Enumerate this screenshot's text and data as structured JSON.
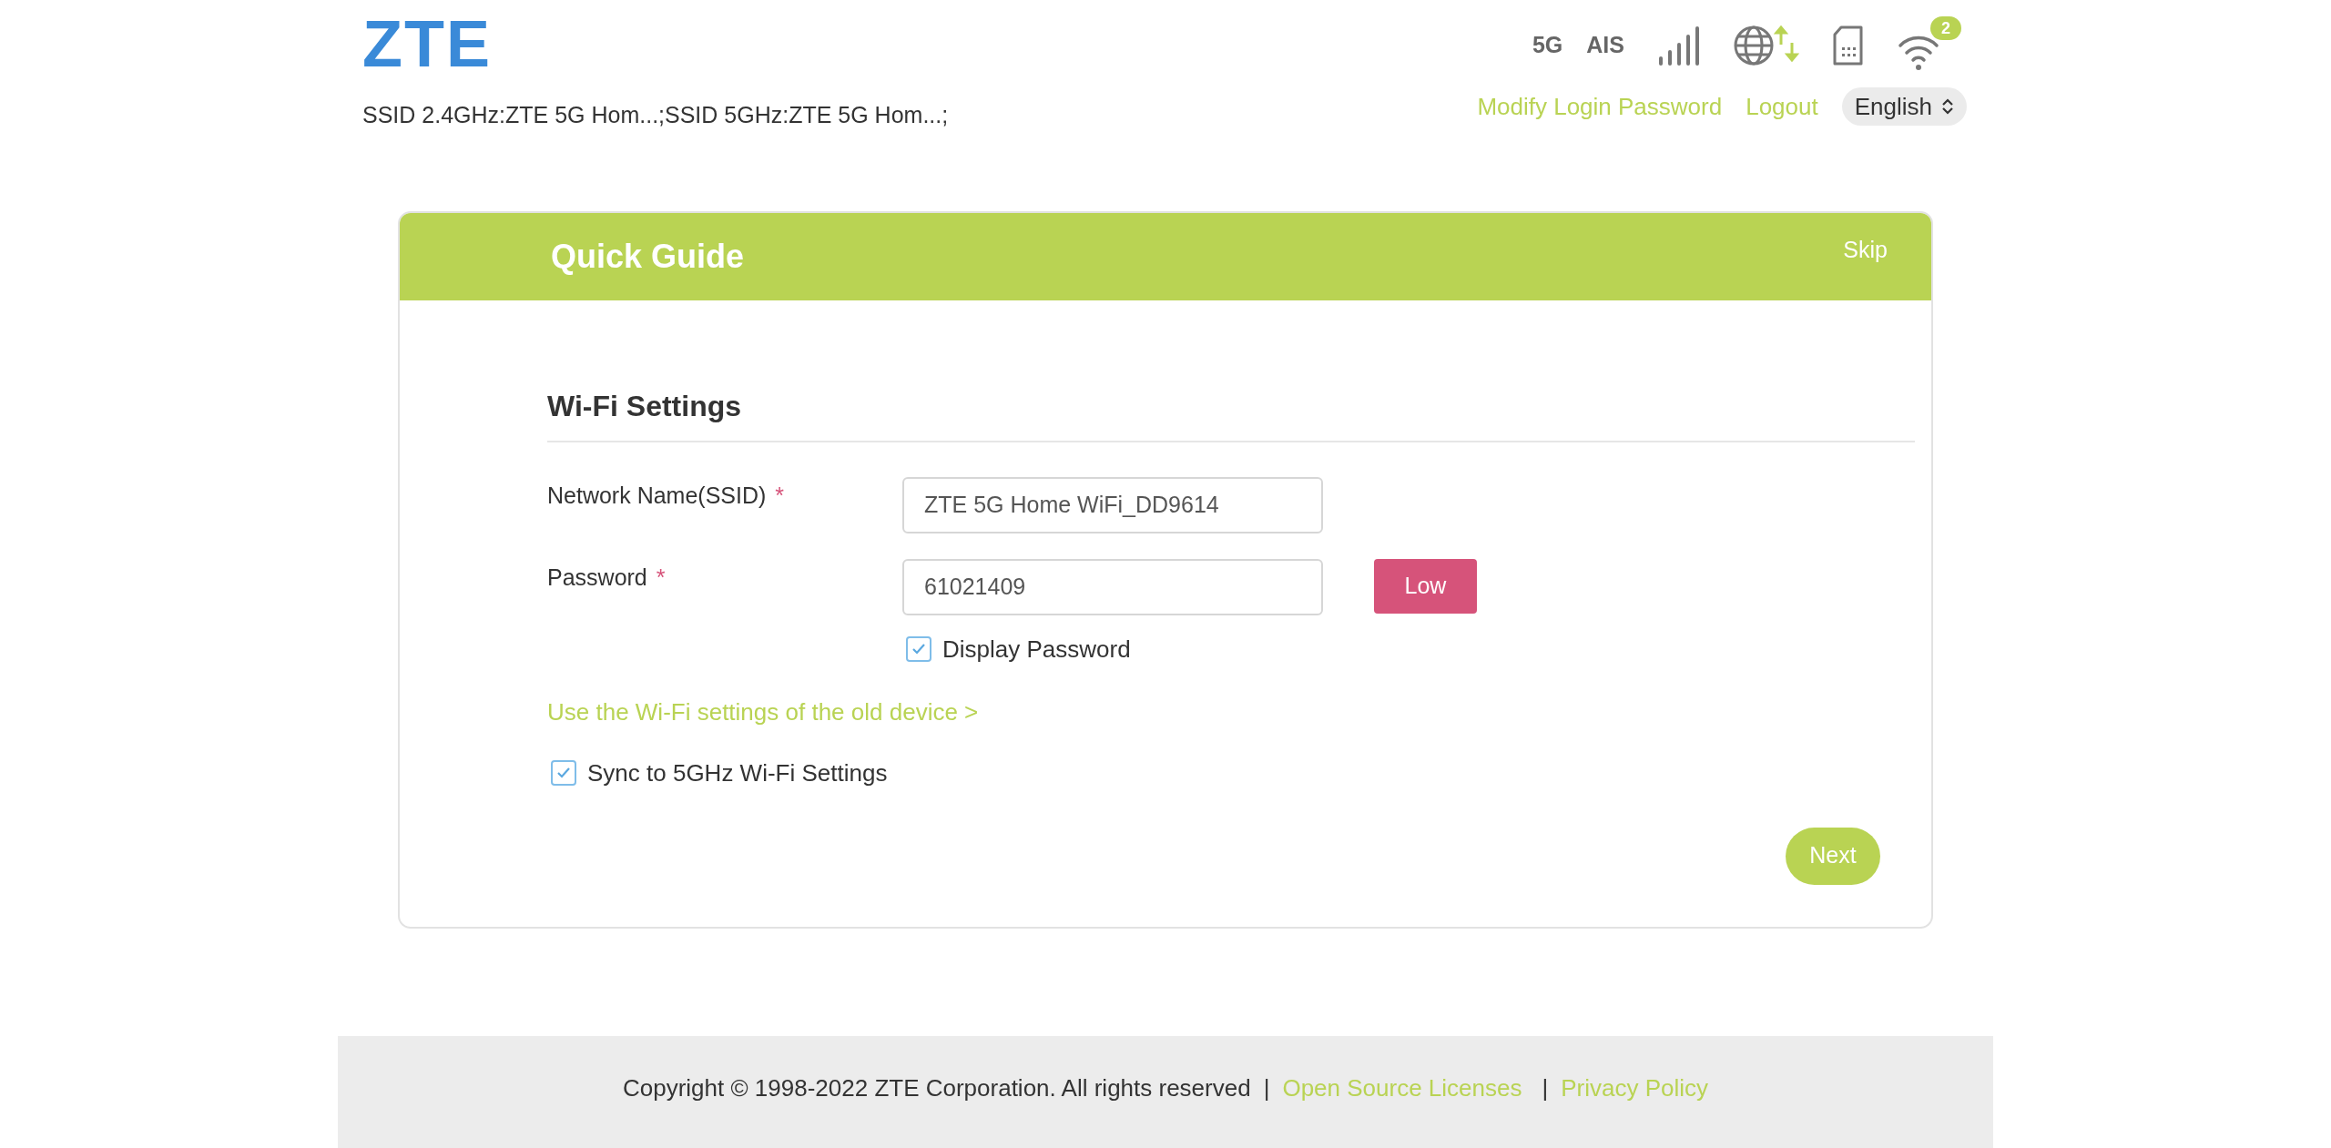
{
  "header": {
    "logo": "ZTE",
    "ssid_summary": "SSID 2.4GHz:ZTE 5G Hom...;SSID 5GHz:ZTE 5G Hom...;",
    "network_type": "5G",
    "operator": "AIS",
    "wifi_clients": "2",
    "links": [
      "Modify Login Password",
      "Logout"
    ],
    "language": "English"
  },
  "card": {
    "title": "Quick Guide",
    "skip": "Skip",
    "section_title": "Wi-Fi Settings",
    "fields": [
      {
        "label": "Network Name(SSID)",
        "required_mark": "*",
        "value": "ZTE 5G Home WiFi_DD9614"
      },
      {
        "label": "Password",
        "required_mark": "*",
        "value": "61021409",
        "strength": "Low"
      }
    ],
    "display_password": {
      "label": "Display Password",
      "checked": true
    },
    "old_device_link": "Use the Wi-Fi settings of the old device >",
    "sync_5ghz": {
      "label": "Sync to 5GHz Wi-Fi Settings",
      "checked": true
    },
    "next": "Next"
  },
  "footer": {
    "copyright": "Copyright © 1998-2022 ZTE Corporation. All rights reserved",
    "separators": [
      "|",
      "|"
    ],
    "links": [
      "Open Source Licenses",
      "Privacy Policy"
    ]
  }
}
